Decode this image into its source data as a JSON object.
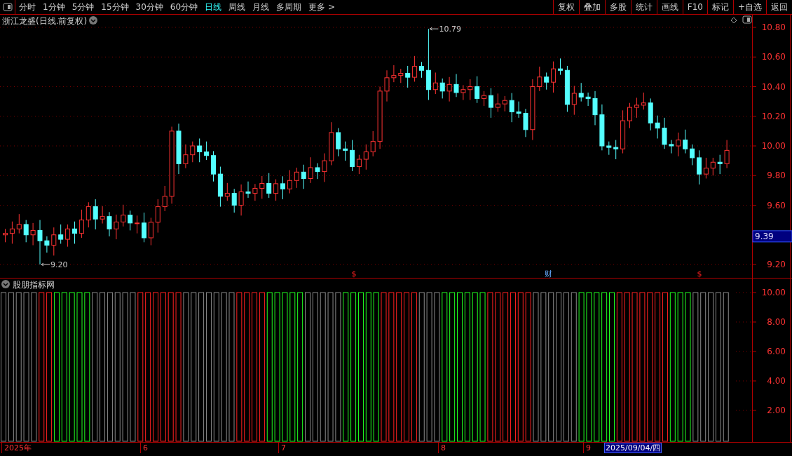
{
  "toolbar": {
    "periods": [
      {
        "label": "分时",
        "selected": false
      },
      {
        "label": "1分钟",
        "selected": false
      },
      {
        "label": "5分钟",
        "selected": false
      },
      {
        "label": "15分钟",
        "selected": false
      },
      {
        "label": "30分钟",
        "selected": false
      },
      {
        "label": "60分钟",
        "selected": false
      },
      {
        "label": "日线",
        "selected": true
      },
      {
        "label": "周线",
        "selected": false
      },
      {
        "label": "月线",
        "selected": false
      },
      {
        "label": "多周期",
        "selected": false
      },
      {
        "label": "更多 >",
        "selected": false
      }
    ],
    "actions": [
      "复权",
      "叠加",
      "多股",
      "统计",
      "画线",
      "F10",
      "标记",
      "+自选",
      "返回"
    ]
  },
  "price_chart": {
    "title": "浙江龙盛(日线.前复权)",
    "y_ticks": [
      "10.80",
      "10.60",
      "10.40",
      "10.20",
      "10.00",
      "9.80",
      "9.60",
      "9.20"
    ],
    "high_label": "10.79",
    "low_label": "9.20",
    "current_price": "9.39",
    "event_marks": [
      {
        "text": "$"
      },
      {
        "text": "财"
      },
      {
        "text": "$"
      }
    ]
  },
  "indicator": {
    "title": "股朋指标网",
    "y_ticks": [
      "10.00",
      "8.00",
      "6.00",
      "4.00",
      "2.00"
    ]
  },
  "date_axis": {
    "labels": [
      "2025年",
      "6",
      "7",
      "8",
      "9"
    ],
    "cursor_date": "2025/09/04/四"
  }
}
